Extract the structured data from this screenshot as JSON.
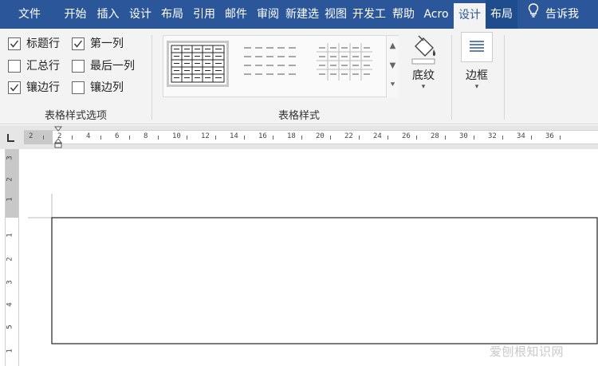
{
  "tabs": [
    {
      "label": "文件"
    },
    {
      "label": "开始"
    },
    {
      "label": "插入"
    },
    {
      "label": "设计"
    },
    {
      "label": "布局"
    },
    {
      "label": "引用"
    },
    {
      "label": "邮件"
    },
    {
      "label": "审阅"
    },
    {
      "label": "新建选"
    },
    {
      "label": "视图"
    },
    {
      "label": "开发工"
    },
    {
      "label": "帮助"
    },
    {
      "label": "Acro"
    },
    {
      "label": "设计"
    },
    {
      "label": "布局"
    },
    {
      "label": "告诉我"
    }
  ],
  "ribbon": {
    "style_options": {
      "group_label": "表格样式选项",
      "header_row": {
        "label": "标题行",
        "checked": true
      },
      "first_column": {
        "label": "第一列",
        "checked": true
      },
      "total_row": {
        "label": "汇总行",
        "checked": false
      },
      "last_column": {
        "label": "最后一列",
        "checked": false
      },
      "banded_rows": {
        "label": "镶边行",
        "checked": true
      },
      "banded_columns": {
        "label": "镶边列",
        "checked": false
      }
    },
    "table_styles": {
      "group_label": "表格样式",
      "shading_label": "底纹"
    },
    "borders": {
      "label": "边框"
    }
  },
  "ruler": {
    "labels": [
      "2",
      "2",
      "4",
      "6",
      "8",
      "10",
      "12",
      "14",
      "16",
      "18",
      "20",
      "22",
      "24",
      "26",
      "28",
      "30",
      "32",
      "34",
      "36"
    ],
    "vertical_labels": [
      "3",
      "2",
      "1",
      "1",
      "2",
      "3",
      "4",
      "5",
      "1"
    ]
  },
  "watermark": "爱刨根知识网",
  "colors": {
    "tab_bar": "#2b579a",
    "ribbon_bg": "#f3f3f3",
    "context_tab": "#1e4c8c"
  }
}
